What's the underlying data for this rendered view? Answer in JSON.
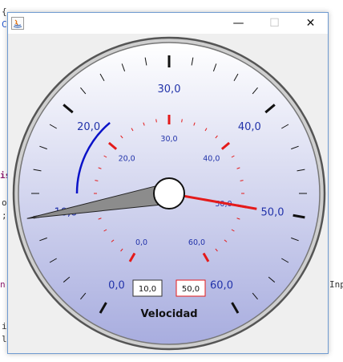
{
  "background": {
    "code_fragments": [
      "{",
      "C",
      "is",
      "o",
      ";",
      "n",
      "i",
      "l",
      "Inp"
    ]
  },
  "window": {
    "controls": {
      "minimize": "—",
      "maximize": "☐",
      "close": "✕"
    }
  },
  "gauge": {
    "title": "Velocidad",
    "min": 0,
    "max": 60,
    "value": 10.0,
    "limit": 50.0,
    "value_display": "10,0",
    "limit_display": "50,0",
    "outer_labels": [
      "0,0",
      "10,0",
      "20,0",
      "30,0",
      "40,0",
      "50,0",
      "60,0"
    ],
    "inner_labels": [
      "0,0",
      "10,0",
      "20,0",
      "30,0",
      "40,0",
      "50,0",
      "60,0"
    ],
    "colors": {
      "outer_label": "#2233aa",
      "inner_label": "#2233aa",
      "inner_ticks": "#e41a1a",
      "limit_needle": "#e41a1a",
      "arc": "#0a12c8",
      "dial_top": "#ffffff",
      "dial_bottom": "#a8addf"
    }
  }
}
